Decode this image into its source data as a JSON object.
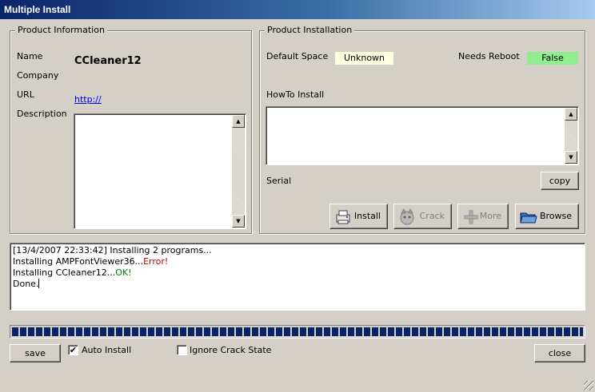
{
  "window": {
    "title": "Multiple Install"
  },
  "product_info": {
    "legend": "Product Information",
    "name_label": "Name",
    "name_value": "CCleaner12",
    "company_label": "Company",
    "url_label": "URL",
    "url_value": "http://",
    "description_label": "Description",
    "description_value": ""
  },
  "product_install": {
    "legend": "Product Installation",
    "default_space_label": "Default Space",
    "default_space_value": "Unknown",
    "needs_reboot_label": "Needs Reboot",
    "needs_reboot_value": "False",
    "howto_label": "HowTo Install",
    "howto_value": "",
    "serial_label": "Serial",
    "copy_label": "copy",
    "install_label": "Install",
    "crack_label": "Crack",
    "more_label": "More",
    "browse_label": "Browse"
  },
  "log": {
    "line1": "[13/4/2007 22:33:42] Installing 2 programs...",
    "line2_prefix": "Installing AMPFontViewer36...",
    "line2_status": "Error!",
    "line3_prefix": "Installing CCleaner12...",
    "line3_status": "OK!",
    "line4": "Done."
  },
  "progress": {
    "fraction": 1.0
  },
  "footer": {
    "save_label": "save",
    "auto_install_label": "Auto Install",
    "auto_install_checked": true,
    "ignore_crack_label": "Ignore Crack State",
    "ignore_crack_checked": false,
    "close_label": "close"
  },
  "colors": {
    "unknown_bg": "#ffffe1",
    "reboot_bg": "#90ee90",
    "error": "#c00000",
    "ok": "#008000",
    "progress": "#0a246a"
  },
  "icons": {
    "install": "printer-install-icon",
    "crack": "crack-icon",
    "more": "plus-icon",
    "browse": "folder-icon",
    "scroll_up": "scroll-up-arrow-icon",
    "scroll_down": "scroll-down-arrow-icon"
  }
}
